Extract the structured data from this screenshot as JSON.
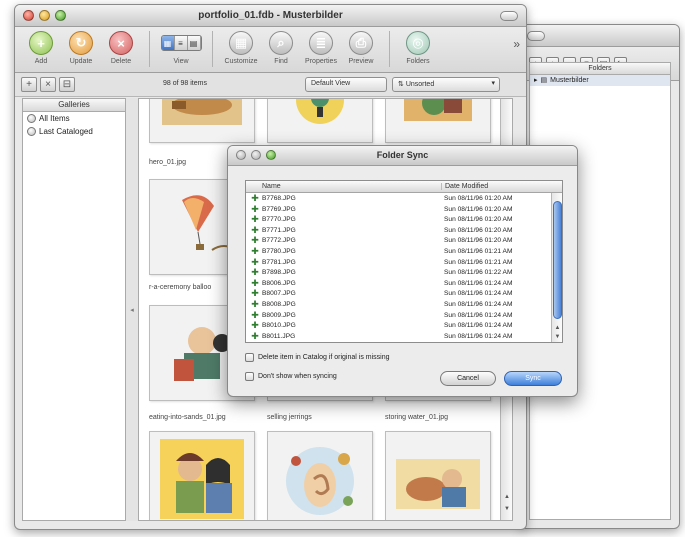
{
  "main_window": {
    "title": "portfolio_01.fdb - Musterbilder",
    "toolbar": [
      {
        "label": "Add",
        "icon": "add-icon"
      },
      {
        "label": "Update",
        "icon": "update-icon"
      },
      {
        "label": "Delete",
        "icon": "delete-icon"
      },
      {
        "label": "View",
        "icon": "view-icon"
      },
      {
        "label": "Customize",
        "icon": "customize-icon"
      },
      {
        "label": "Find",
        "icon": "find-icon"
      },
      {
        "label": "Properties",
        "icon": "properties-icon"
      },
      {
        "label": "Preview",
        "icon": "preview-icon"
      },
      {
        "label": "Folders",
        "icon": "folders-icon"
      }
    ],
    "item_count": "98 of 98 items",
    "view_popup": "Default View",
    "sort_popup": "Unsorted",
    "sidebar": {
      "header": "Galleries",
      "items": [
        "All Items",
        "Last Cataloged"
      ]
    },
    "thumbnails": {
      "row1_caption": "hero_01.jpg",
      "row2_caption": "r-a-ceremony balloo",
      "row3_captions": [
        "eating-into-sands_01.jpg",
        "selling jerrings",
        "storing water_01.jpg"
      ]
    }
  },
  "folders_window": {
    "list_header": "Folders",
    "root_item": "Musterbilder"
  },
  "dialog": {
    "title": "Folder Sync",
    "col_name": "Name",
    "col_date": "Date Modified",
    "rows": [
      {
        "name": "B7768.JPG",
        "date": "Sun 08/11/96 01:20 AM"
      },
      {
        "name": "B7769.JPG",
        "date": "Sun 08/11/96 01:20 AM"
      },
      {
        "name": "B7770.JPG",
        "date": "Sun 08/11/96 01:20 AM"
      },
      {
        "name": "B7771.JPG",
        "date": "Sun 08/11/96 01:20 AM"
      },
      {
        "name": "B7772.JPG",
        "date": "Sun 08/11/96 01:20 AM"
      },
      {
        "name": "B7780.JPG",
        "date": "Sun 08/11/96 01:21 AM"
      },
      {
        "name": "B7781.JPG",
        "date": "Sun 08/11/96 01:21 AM"
      },
      {
        "name": "B7898.JPG",
        "date": "Sun 08/11/96 01:22 AM"
      },
      {
        "name": "B8006.JPG",
        "date": "Sun 08/11/96 01:24 AM"
      },
      {
        "name": "B8007.JPG",
        "date": "Sun 08/11/96 01:24 AM"
      },
      {
        "name": "B8008.JPG",
        "date": "Sun 08/11/96 01:24 AM"
      },
      {
        "name": "B8009.JPG",
        "date": "Sun 08/11/96 01:24 AM"
      },
      {
        "name": "B8010.JPG",
        "date": "Sun 08/11/96 01:24 AM"
      },
      {
        "name": "B8011.JPG",
        "date": "Sun 08/11/96 01:24 AM"
      }
    ],
    "checkbox1": "Delete item in Catalog if original is missing",
    "checkbox2": "Don't show when syncing",
    "cancel": "Cancel",
    "sync": "Sync"
  }
}
